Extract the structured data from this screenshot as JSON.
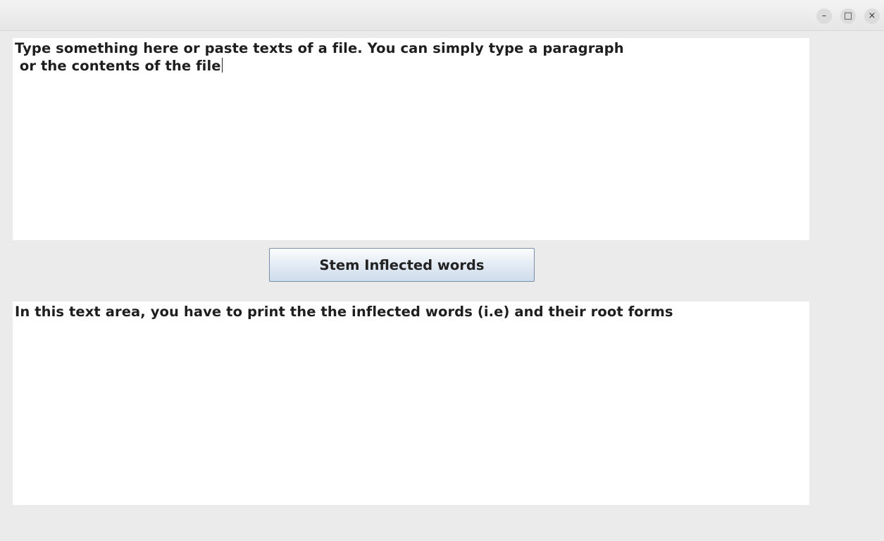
{
  "window": {
    "controls": {
      "minimize_glyph": "–",
      "maximize_glyph": "□",
      "close_glyph": "×"
    }
  },
  "input_area": {
    "text": "Type something here or paste texts of a file. You can simply type a paragraph\n or the contents of the file"
  },
  "stem_button": {
    "label": "Stem Inflected words"
  },
  "output_area": {
    "text": "In this text area, you have to print the the inflected words (i.e) and their root forms"
  },
  "colors": {
    "window_bg": "#ebebeb",
    "textarea_bg": "#ffffff",
    "button_border": "#7a8ea8"
  }
}
